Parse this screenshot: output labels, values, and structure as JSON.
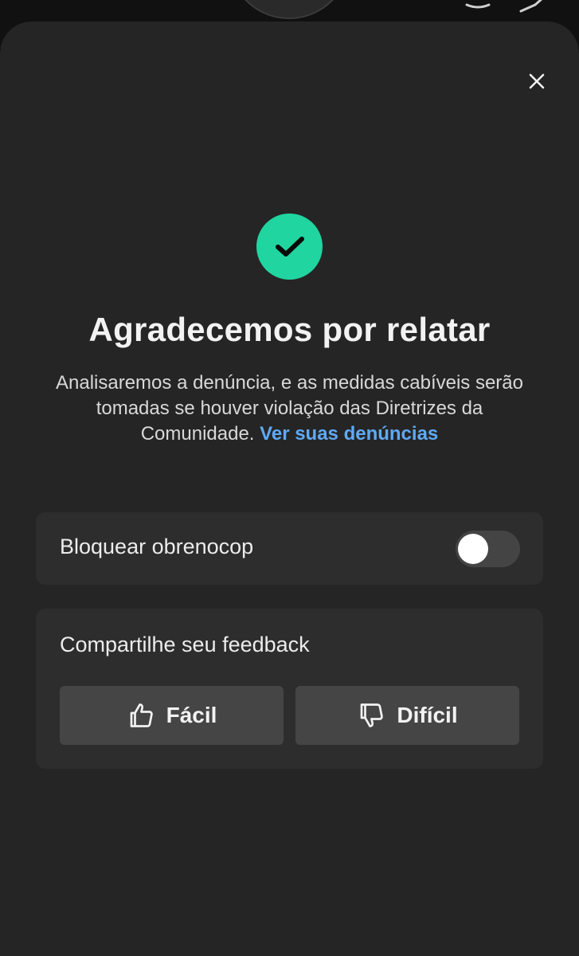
{
  "dialog": {
    "title": "Agradecemos por relatar",
    "description": "Analisaremos a denúncia, e as medidas cabíveis serão tomadas se houver violação das Diretrizes da Comunidade.",
    "link_label": "Ver suas denúncias",
    "close_icon": "close-icon",
    "status_icon": "check-circle-icon"
  },
  "block": {
    "label": "Bloquear obrenocop",
    "enabled": false
  },
  "feedback": {
    "label": "Compartilhe seu feedback",
    "easy_label": "Fácil",
    "hard_label": "Difícil"
  },
  "colors": {
    "accent_check": "#20d5a0",
    "link": "#5fa9f5",
    "sheet_bg": "#252525",
    "card_bg": "#2d2d2d"
  }
}
